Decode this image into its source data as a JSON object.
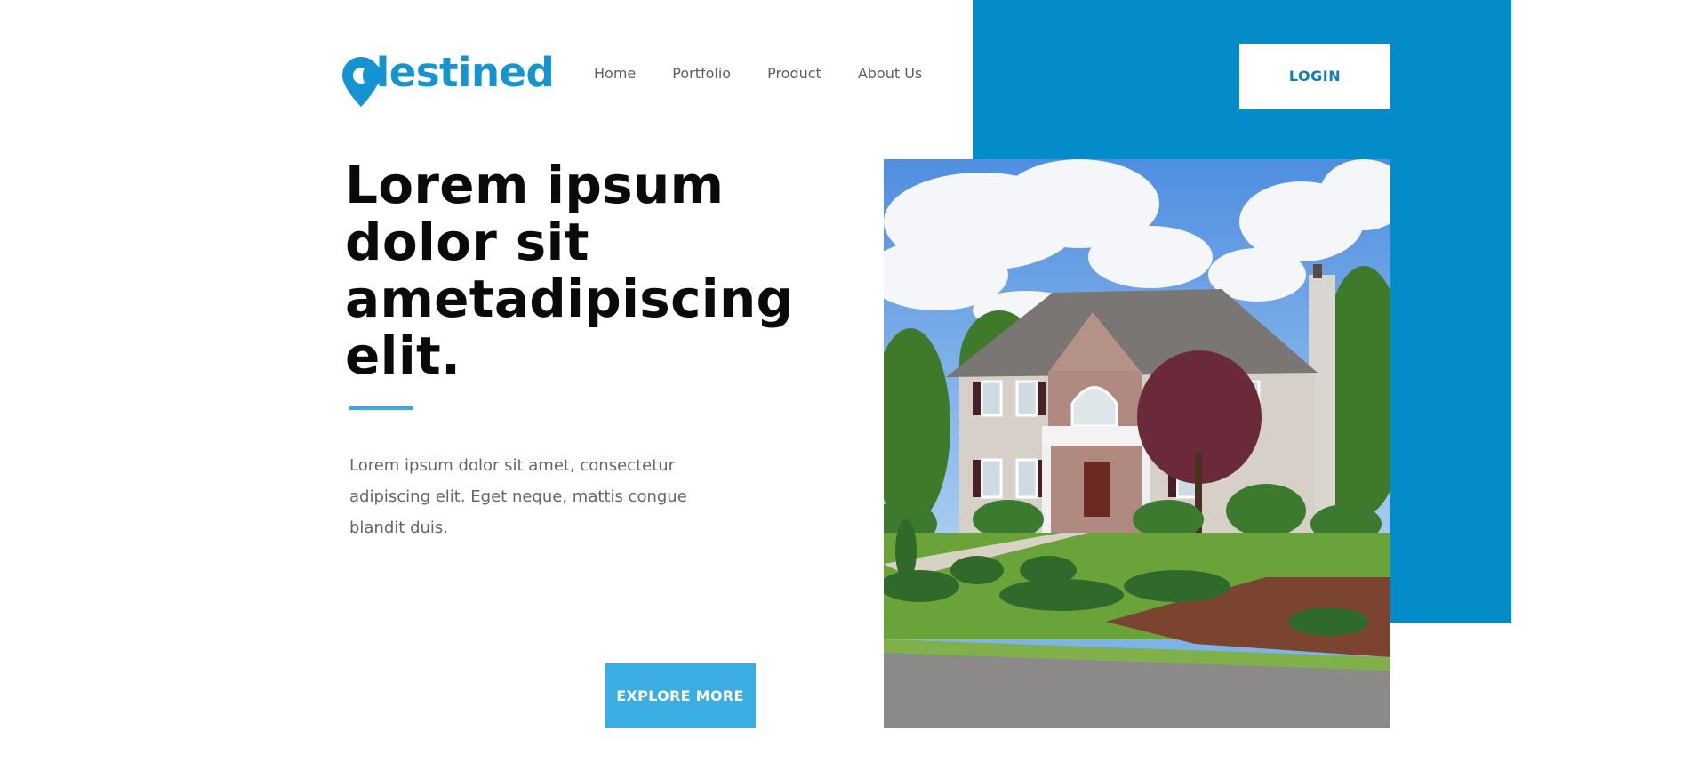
{
  "brand": {
    "logo_text": "destined",
    "accent_color": "#038bca",
    "button_color": "#3aaee2"
  },
  "nav": {
    "items": [
      {
        "label": "Home"
      },
      {
        "label": "Portfolio"
      },
      {
        "label": "Product"
      },
      {
        "label": "About Us"
      }
    ]
  },
  "header": {
    "login_label": "LOGIN"
  },
  "hero": {
    "headline_lines": [
      "Lorem ipsum",
      "dolor sit",
      "ametadipiscing",
      "elit."
    ],
    "body_text": "Lorem ipsum dolor sit amet, consectetur adipiscing elit. Eget neque, mattis congue blandit duis.",
    "cta_label": "EXPLORE MORE",
    "image_subject": "two-story-house-photo"
  }
}
